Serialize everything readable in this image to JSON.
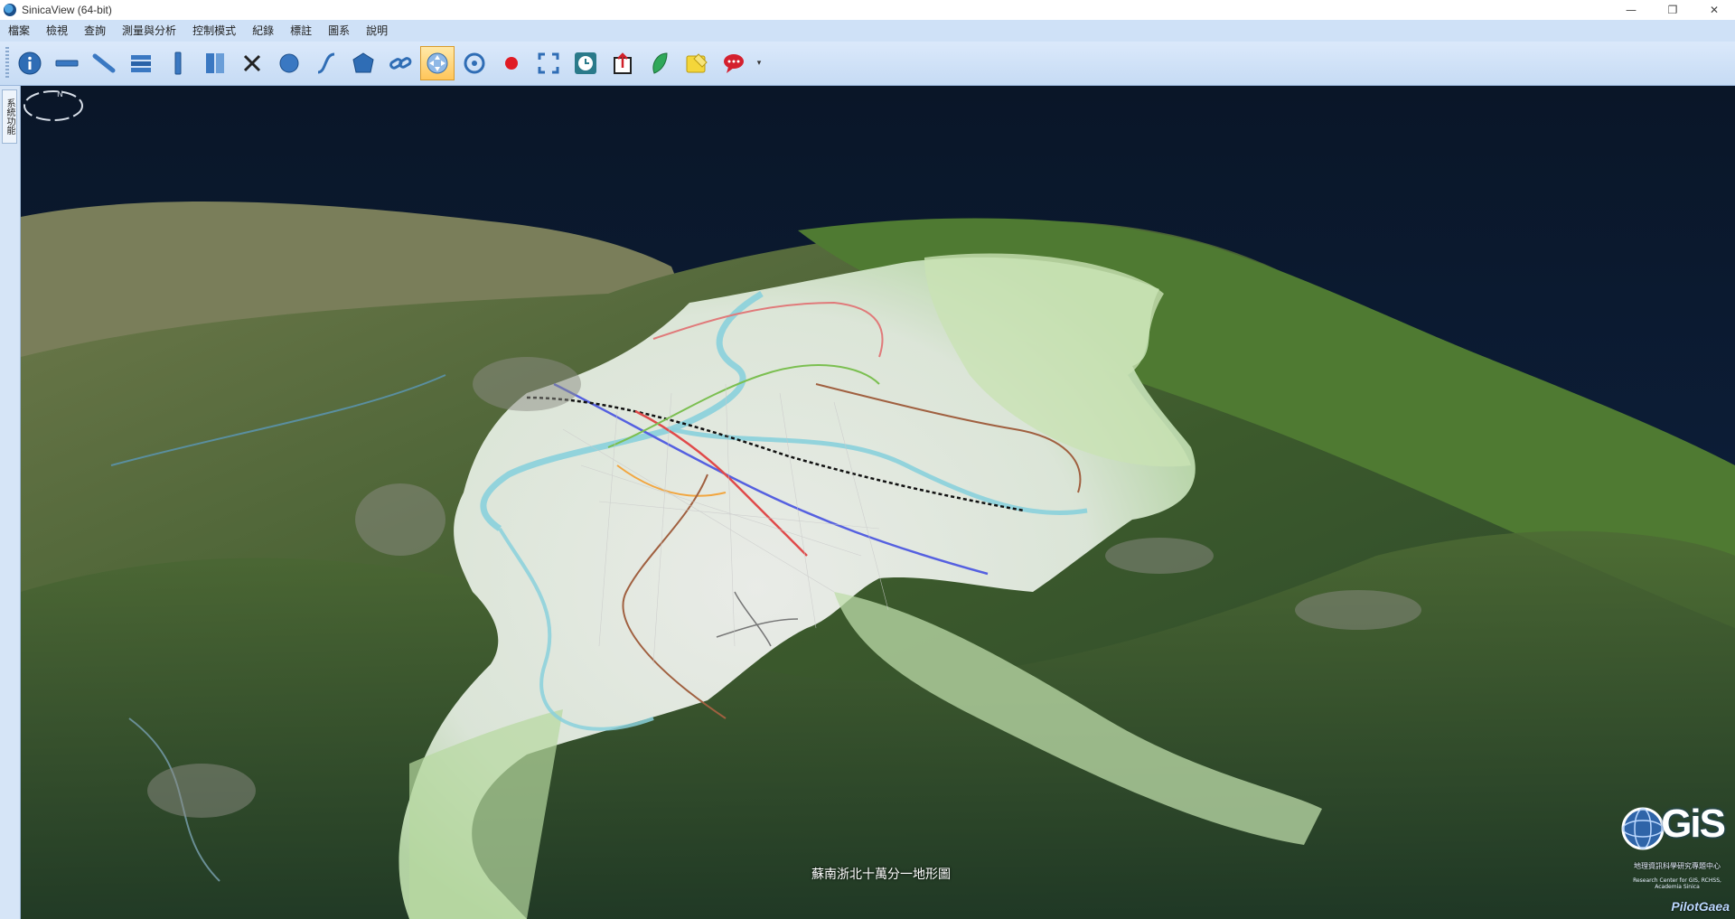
{
  "window": {
    "title": "SinicaView (64-bit)",
    "controls": {
      "minimize": "—",
      "restore": "❐",
      "close": "✕"
    }
  },
  "menu": [
    "檔案",
    "檢視",
    "查詢",
    "測量與分析",
    "控制模式",
    "紀錄",
    "標註",
    "圖系",
    "說明"
  ],
  "toolbar": {
    "buttons": [
      {
        "name": "info",
        "icon": "info-icon"
      },
      {
        "name": "horizontal-line",
        "icon": "horizontal-line-icon"
      },
      {
        "name": "diagonal-line",
        "icon": "diagonal-line-icon"
      },
      {
        "name": "stack",
        "icon": "stack-icon"
      },
      {
        "name": "vertical-line",
        "icon": "vertical-line-icon"
      },
      {
        "name": "columns",
        "icon": "columns-icon"
      },
      {
        "name": "clear",
        "icon": "close-icon"
      },
      {
        "name": "circle",
        "icon": "circle-icon"
      },
      {
        "name": "curve",
        "icon": "curve-icon"
      },
      {
        "name": "polygon",
        "icon": "polygon-icon"
      },
      {
        "name": "link",
        "icon": "link-icon"
      },
      {
        "name": "navigate",
        "icon": "navigate-icon",
        "active": true
      },
      {
        "name": "rotate",
        "icon": "rotate-icon"
      },
      {
        "name": "record",
        "icon": "record-icon"
      },
      {
        "name": "fullscreen",
        "icon": "fullscreen-icon"
      },
      {
        "name": "history",
        "icon": "history-icon"
      },
      {
        "name": "export",
        "icon": "export-icon"
      },
      {
        "name": "leaf",
        "icon": "leaf-icon"
      },
      {
        "name": "note",
        "icon": "note-icon"
      },
      {
        "name": "comment",
        "icon": "comment-icon"
      }
    ],
    "dropdown": "▾"
  },
  "side_panel": {
    "tab_label": "系統功能"
  },
  "map": {
    "label": "蘇南浙北十萬分一地形圖",
    "logo": {
      "text": "GiS",
      "caption": "地理資訊科學研究專題中心",
      "sub": "Research Center for GIS, RCHSS, Academia Sinica",
      "pilot": "PilotGaea"
    }
  },
  "colors": {
    "menubar": "#cfe1f7",
    "toolbar": "#c6dbf4",
    "active_button": "#ffc65a",
    "sea": "#0b1a33",
    "overlay_map": "#eef2ee"
  }
}
